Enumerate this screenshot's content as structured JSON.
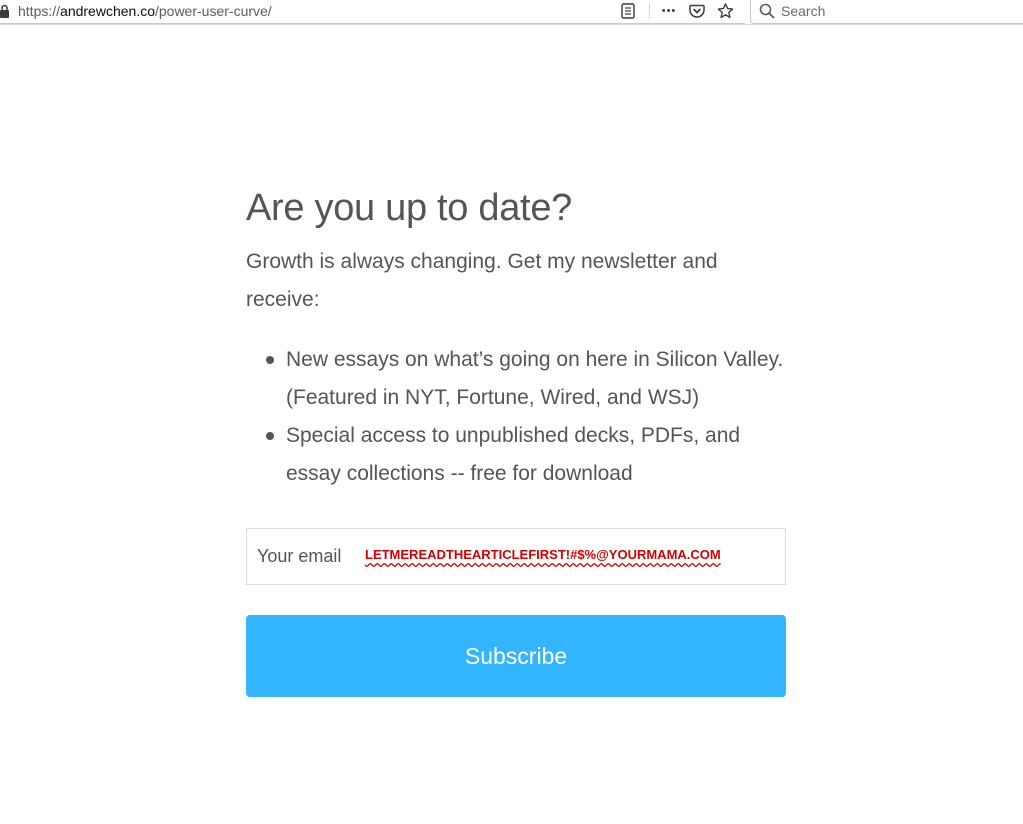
{
  "browser": {
    "url_prefix": "https://",
    "url_domain": "andrewchen.co",
    "url_path": "/power-user-curve/",
    "search_placeholder": "Search",
    "more_glyph": "•••"
  },
  "icons": {
    "lock": "lock-icon",
    "reader_view": "reader-view-icon",
    "more": "more-actions-icon",
    "pocket": "pocket-icon",
    "bookmark": "bookmark-star-icon",
    "search": "search-icon"
  },
  "signup": {
    "heading": "Are you up to date?",
    "intro": "Growth is always changing. Get my newsletter and receive:",
    "benefits": [
      "New essays on what’s going on here in Silicon Valley. (Featured in NYT, Fortune, Wired, and WSJ)",
      "Special access to unpublished decks, PDFs, and essay collections -- free for download"
    ],
    "email_label": "Your email",
    "email_value": "LETMEREADTHEARTICLEFIRST!#$%@YOURMAMA.COM",
    "subscribe_label": "Subscribe"
  },
  "colors": {
    "accent": "#33b5ff",
    "text": "#555555",
    "email_value": "#d40000"
  }
}
